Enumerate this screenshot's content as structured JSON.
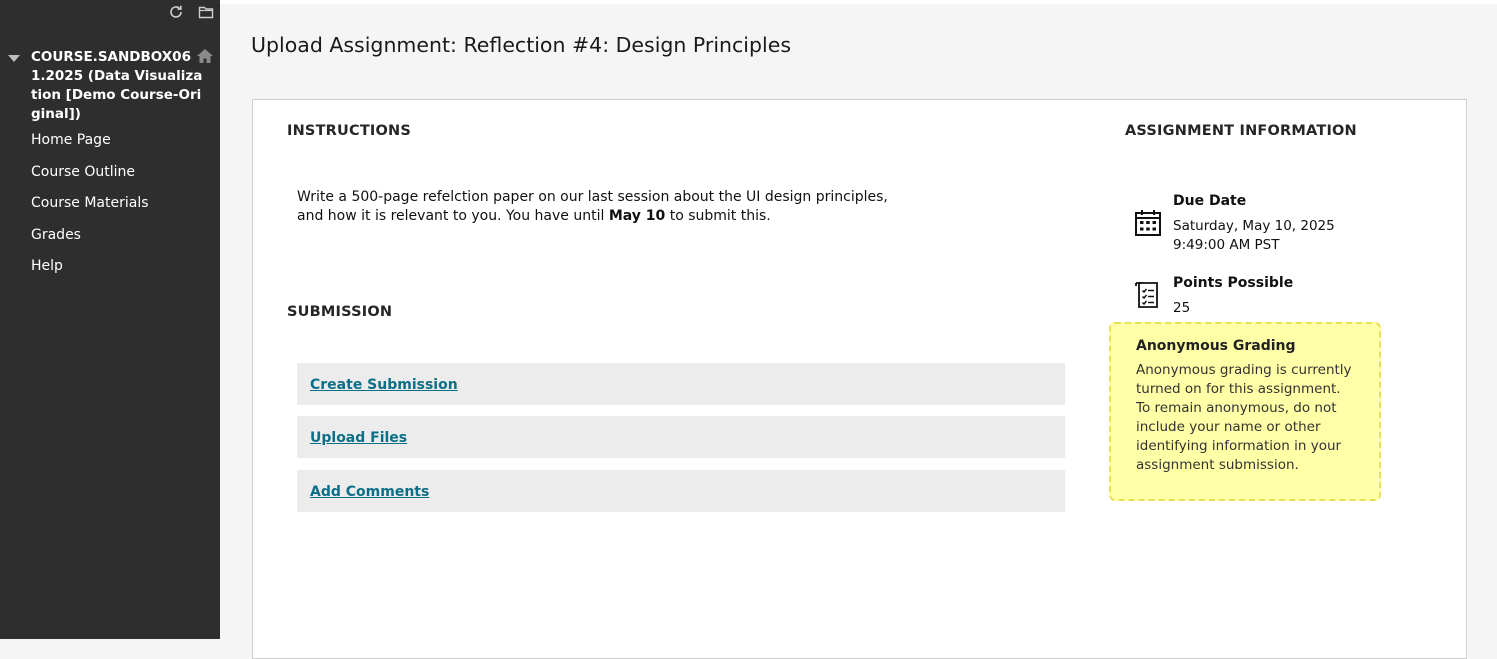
{
  "sidebar": {
    "course_title": "COURSE.SANDBOX061.2025 (Data Visualization [Demo Course-Original])",
    "tools": [
      "refresh-icon",
      "folder-icon"
    ],
    "items": [
      {
        "label": "Home Page"
      },
      {
        "label": "Course Outline"
      },
      {
        "label": "Course Materials"
      },
      {
        "label": "Grades"
      },
      {
        "label": "Help"
      }
    ]
  },
  "page": {
    "title": "Upload Assignment: Reflection #4: Design Principles"
  },
  "instructions": {
    "heading": "INSTRUCTIONS",
    "text_before": "Write a 500-page refelction paper on our last session about the UI design principles, and how it is relevant to you. You have until ",
    "text_bold": "May 10",
    "text_after": " to submit this."
  },
  "submission": {
    "heading": "SUBMISSION",
    "actions": [
      {
        "label": "Create Submission"
      },
      {
        "label": "Upload Files"
      },
      {
        "label": "Add Comments"
      }
    ]
  },
  "assignment_info": {
    "heading": "ASSIGNMENT INFORMATION",
    "due_date_label": "Due Date",
    "due_date_line1": "Saturday, May 10, 2025",
    "due_date_line2": "9:49:00 AM PST",
    "points_label": "Points Possible",
    "points_value": "25"
  },
  "anonymous_grading": {
    "title": "Anonymous Grading",
    "text": "Anonymous grading is currently turned on for this assignment. To remain anonymous, do not include your name or other identifying information in your assignment submission."
  },
  "colors": {
    "sidebar_bg": "#2e2e2e",
    "link": "#0a6f87",
    "notice_bg": "#ffffa8",
    "notice_border": "#e8e057"
  }
}
